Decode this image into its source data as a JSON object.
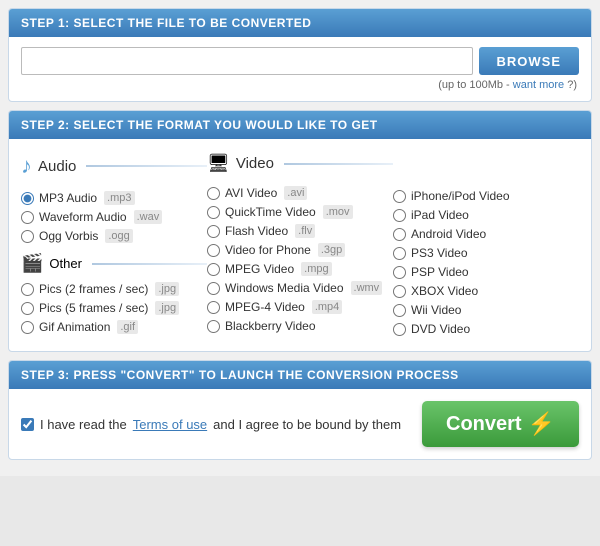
{
  "step1": {
    "header": "STEP 1: SELECT THE FILE TO BE CONVERTED",
    "browse_label": "BROWSE",
    "file_limit": "(up to 100Mb -",
    "want_more": "want more",
    "question_mark": "?)"
  },
  "step2": {
    "header": "STEP 2: SELECT THE FORMAT YOU WOULD LIKE TO GET",
    "audio": {
      "title": "Audio",
      "options": [
        {
          "label": "MP3 Audio",
          "ext": ".mp3",
          "selected": true
        },
        {
          "label": "Waveform Audio",
          "ext": ".wav",
          "selected": false
        },
        {
          "label": "Ogg Vorbis",
          "ext": ".ogg",
          "selected": false
        }
      ]
    },
    "other": {
      "title": "Other",
      "options": [
        {
          "label": "Pics (2 frames / sec)",
          "ext": ".jpg",
          "selected": false
        },
        {
          "label": "Pics (5 frames / sec)",
          "ext": ".jpg",
          "selected": false
        },
        {
          "label": "Gif Animation",
          "ext": ".gif",
          "selected": false
        }
      ]
    },
    "video": {
      "title": "Video",
      "col1": [
        {
          "label": "AVI Video",
          "ext": ".avi",
          "selected": false
        },
        {
          "label": "QuickTime Video",
          "ext": ".mov",
          "selected": false
        },
        {
          "label": "Flash Video",
          "ext": ".flv",
          "selected": false
        },
        {
          "label": "Video for Phone",
          "ext": ".3gp",
          "selected": false
        },
        {
          "label": "MPEG Video",
          "ext": ".mpg",
          "selected": false
        },
        {
          "label": "Windows Media Video",
          "ext": ".wmv",
          "selected": false
        },
        {
          "label": "MPEG-4 Video",
          "ext": ".mp4",
          "selected": false
        },
        {
          "label": "Blackberry Video",
          "ext": "",
          "selected": false
        }
      ],
      "col2": [
        {
          "label": "iPhone/iPod Video",
          "ext": "",
          "selected": false
        },
        {
          "label": "iPad Video",
          "ext": "",
          "selected": false
        },
        {
          "label": "Android Video",
          "ext": "",
          "selected": false
        },
        {
          "label": "PS3 Video",
          "ext": "",
          "selected": false
        },
        {
          "label": "PSP Video",
          "ext": "",
          "selected": false
        },
        {
          "label": "XBOX Video",
          "ext": "",
          "selected": false
        },
        {
          "label": "Wii Video",
          "ext": "",
          "selected": false
        },
        {
          "label": "DVD Video",
          "ext": "",
          "selected": false
        }
      ]
    }
  },
  "step3": {
    "header": "STEP 3: PRESS \"CONVERT\" TO LAUNCH THE CONVERSION PROCESS",
    "tos_text": "I have read the",
    "tos_link": "Terms of use",
    "tos_after": "and I agree to be bound by them",
    "convert_label": "Convert"
  },
  "colors": {
    "blue_header": "#3a7ab8",
    "green_btn": "#3a9a3a"
  }
}
